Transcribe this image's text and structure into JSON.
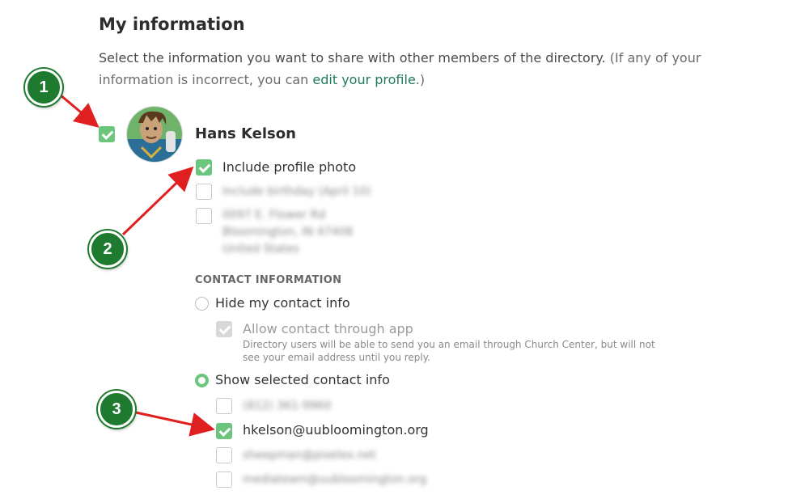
{
  "header": {
    "title": "My information",
    "intro_main": "Select the information you want to share with other members of the directory. ",
    "intro_muted_before": "(If any of your information is incorrect, you can ",
    "intro_link": "edit your profile",
    "intro_muted_after": ".)"
  },
  "profile": {
    "name": "Hans Kelson",
    "share_checked": true,
    "include_photo_label": "Include profile photo",
    "include_photo_checked": true,
    "birthday_blurred": "Include birthday (April 10)",
    "address_blurred": [
      "0097 E. Flower Rd",
      "Bloomington, IN 47408",
      "United States"
    ]
  },
  "contact": {
    "section_label": "CONTACT INFORMATION",
    "hide_label": "Hide my contact info",
    "allow_label": "Allow contact through app",
    "allow_help": "Directory users will be able to send you an email through Church Center, but will not see your email address until you reply.",
    "show_label": "Show selected contact info",
    "phone_blurred": "(812) 361-9960",
    "email_visible": "hkelson@uubloomington.org",
    "email2_blurred": "sheepman@pixelex.net",
    "email3_blurred": "mediateam@uubloomington.org"
  },
  "annotations": {
    "badge1": "1",
    "badge2": "2",
    "badge3": "3"
  },
  "colors": {
    "accent_green": "#6cc57c",
    "badge_green": "#1d7a2e",
    "arrow_red": "#e02020",
    "link": "#1f7a5c"
  }
}
